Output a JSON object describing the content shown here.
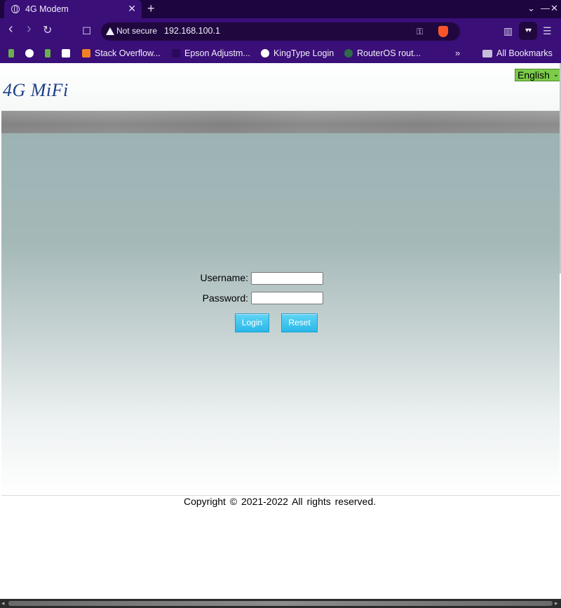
{
  "browser": {
    "tab_title": "4G Modem",
    "tab_close": "✕",
    "new_tab": "+",
    "win_controls": [
      "⌄",
      "—",
      "✕"
    ],
    "nav": {
      "back": "‹",
      "forward": "›",
      "reload": "↻",
      "bookmark": "◻"
    },
    "security_label": "Not secure",
    "url": "192.168.100.1",
    "key_icon": "⚿",
    "sidebar_icon": "▥",
    "wallet_label": "▾▾",
    "menu_icon": "☰"
  },
  "bookmarks": {
    "items": [
      {
        "label": "",
        "icon_color": "#6ab04c"
      },
      {
        "label": "",
        "icon_color": "#ffffff"
      },
      {
        "label": "",
        "icon_color": "#6ab04c"
      },
      {
        "label": "",
        "icon_color": "#ffffff"
      },
      {
        "label": "Stack Overflow...",
        "icon_color": "#f48024"
      },
      {
        "label": "Epson Adjustm...",
        "icon_color": "#3a0f78"
      },
      {
        "label": "KingType Login",
        "icon_color": "#ffffff"
      },
      {
        "label": "RouterOS rout...",
        "icon_color": "#2e6b4a"
      }
    ],
    "more": "»",
    "all_bookmarks": "All Bookmarks"
  },
  "page": {
    "logo": "4G MiFi",
    "language": {
      "selected": "English",
      "arrow": "⌄"
    },
    "login": {
      "username_label": "Username:",
      "username_value": "",
      "password_label": "Password:",
      "password_value": "",
      "login_button": "Login",
      "reset_button": "Reset"
    },
    "copyright": "Copyright © 2021-2022 All rights reserved."
  },
  "scrollbar": {
    "left_arrow": "◂",
    "right_arrow": "▸"
  },
  "colors": {
    "chrome_purple": "#3a0f78",
    "tabstrip": "#1d0540",
    "logo_blue": "#1c3f8a",
    "language_green": "#7ccc4a",
    "button_cyan": "#2ab8e8"
  }
}
